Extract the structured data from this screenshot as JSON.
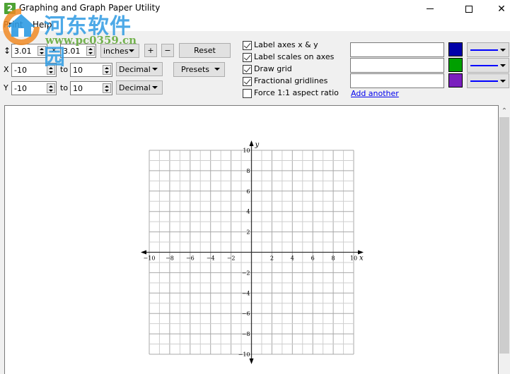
{
  "window": {
    "icon_text": "2",
    "title": "Graphing and Graph Paper Utility",
    "controls": [
      "minimize",
      "maximize",
      "close"
    ]
  },
  "menu": {
    "items": [
      {
        "label": "Print"
      },
      {
        "label": "Help"
      }
    ]
  },
  "watermark": {
    "title": "河东软件园",
    "url": "www.pc0359.cn"
  },
  "size": {
    "icon": "vertical-resize-icon",
    "width": "3.01",
    "times": "×",
    "height": "3.01",
    "unit": "inches",
    "plus_label": "+",
    "minus_label": "−",
    "reset_label": "Reset"
  },
  "x_range": {
    "label": "X",
    "from": "-10",
    "to_label": "to",
    "to": "10",
    "format": "Decimal"
  },
  "y_range": {
    "label": "Y",
    "from": "-10",
    "to_label": "to",
    "to": "10",
    "format": "Decimal"
  },
  "presets_label": "Presets",
  "options": [
    {
      "label": "Label axes x & y",
      "checked": true
    },
    {
      "label": "Label scales on axes",
      "checked": true
    },
    {
      "label": "Draw grid",
      "checked": true
    },
    {
      "label": "Fractional gridlines",
      "checked": true
    },
    {
      "label": "Force 1:1 aspect ratio",
      "checked": false
    }
  ],
  "functions": [
    {
      "value": "",
      "color": "#0000a8",
      "line_color": "#0000ff",
      "line_style": "solid"
    },
    {
      "value": "",
      "color": "#00a000",
      "line_color": "#0000ff",
      "line_style": "solid"
    },
    {
      "value": "",
      "color": "#7a1fbe",
      "line_color": "#0000ff",
      "line_style": "solid"
    }
  ],
  "add_another_label": "Add another",
  "graph": {
    "x_axis_label": "x",
    "y_axis_label": "y",
    "xmin": -10,
    "xmax": 10,
    "ymin": -10,
    "ymax": 10,
    "grid_step": 1,
    "label_step": 2,
    "x_tick_labels": [
      "−10",
      "−8",
      "−6",
      "−4",
      "−2",
      "2",
      "4",
      "6",
      "8",
      "10"
    ],
    "y_tick_labels": [
      "10",
      "8",
      "6",
      "4",
      "2",
      "−2",
      "−4",
      "−6",
      "−8",
      "−10"
    ]
  }
}
